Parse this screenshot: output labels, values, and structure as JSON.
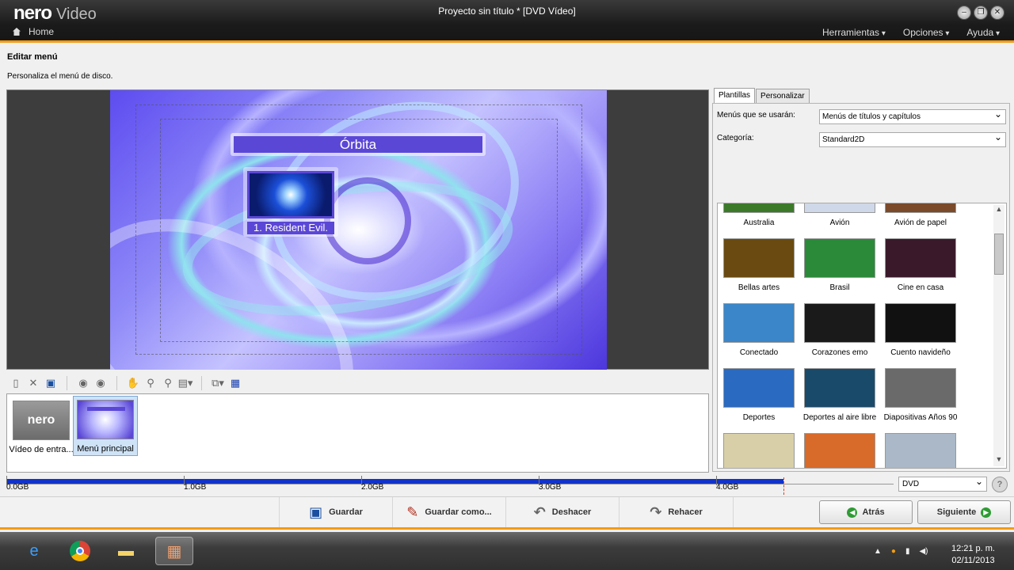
{
  "app": {
    "logo": "nero",
    "logo_sub": "Video",
    "window_title": "Proyecto sin título * [DVD Vídeo]",
    "home_label": "Home",
    "menus": [
      "Herramientas",
      "Opciones",
      "Ayuda"
    ],
    "accent": "#f39c12"
  },
  "page": {
    "title": "Editar menú",
    "description": "Personaliza el menú de disco."
  },
  "preview": {
    "menu_title": "Órbita",
    "chapter_label": "1. Resident Evil."
  },
  "strip": {
    "items": [
      {
        "label": "Vídeo de entra...",
        "thumb_text": "nero"
      },
      {
        "label": "Menú principal"
      }
    ]
  },
  "right_panel": {
    "tabs": [
      "Plantillas",
      "Personalizar"
    ],
    "menus_label": "Menús que se usarán:",
    "menus_value": "Menús de títulos y capítulos",
    "category_label": "Categoría:",
    "category_value": "Standard2D",
    "templates": [
      {
        "name": "Australia",
        "color": "#3c7a2a"
      },
      {
        "name": "Avión",
        "color": "#cfd8e8"
      },
      {
        "name": "Avión de papel",
        "color": "#7a4a2a"
      },
      {
        "name": "Bellas artes",
        "color": "#6a4a10"
      },
      {
        "name": "Brasil",
        "color": "#2a8a3a"
      },
      {
        "name": "Cine en casa",
        "color": "#3a1a2a"
      },
      {
        "name": "Conectado",
        "color": "#3a86c8"
      },
      {
        "name": "Corazones emo",
        "color": "#1a1a1a"
      },
      {
        "name": "Cuento navideño",
        "color": "#111111"
      },
      {
        "name": "Deportes",
        "color": "#2a6ac0"
      },
      {
        "name": "Deportes al aire libre",
        "color": "#1a4a6a"
      },
      {
        "name": "Diapositivas Años 90",
        "color": "#6a6a6a"
      },
      {
        "name": "",
        "color": "#d8cfa8"
      },
      {
        "name": "",
        "color": "#d86a2a"
      },
      {
        "name": "",
        "color": "#aab8c8"
      }
    ]
  },
  "capacity": {
    "ticks": [
      "0.0GB",
      "1.0GB",
      "2.0GB",
      "3.0GB",
      "4.0GB"
    ],
    "used_fraction": 0.876,
    "disc_type": "DVD"
  },
  "buttons": {
    "save": "Guardar",
    "save_as": "Guardar como...",
    "undo": "Deshacer",
    "redo": "Rehacer",
    "back": "Atrás",
    "next": "Siguiente"
  },
  "taskbar": {
    "time": "12:21 p. m.",
    "date": "02/11/2013"
  }
}
